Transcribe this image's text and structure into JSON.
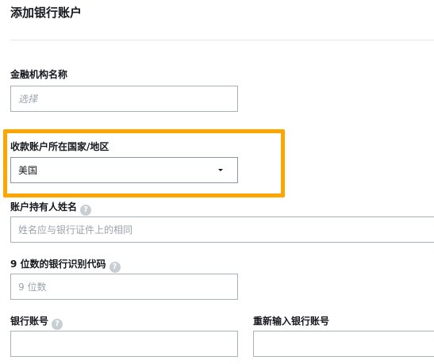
{
  "header": {
    "title": "添加银行账户"
  },
  "form": {
    "institution": {
      "label": "金融机构名称",
      "placeholder": "选择"
    },
    "country": {
      "label": "收款账户所在国家/地区",
      "value": "美国"
    },
    "holder": {
      "label": "账户持有人姓名",
      "placeholder": "姓名应与银行证件上的相同"
    },
    "routing": {
      "label": "9 位数的银行识别代码",
      "placeholder": "9 位数"
    },
    "account": {
      "label": "银行账号"
    },
    "account_confirm": {
      "label": "重新输入银行账号"
    }
  },
  "icons": {
    "help": "question-circle-icon",
    "dropdown": "caret-down-icon"
  },
  "colors": {
    "highlight": "#ffa500",
    "border": "#a8b0b8",
    "help_icon": "#c9ced3"
  }
}
